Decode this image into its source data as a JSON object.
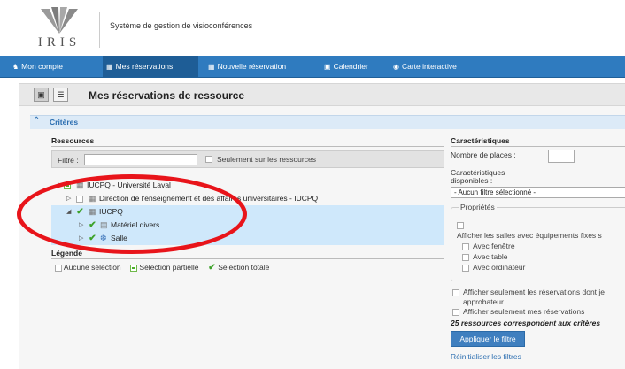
{
  "app": {
    "logo_text": "IRIS",
    "title": "Système de gestion de visioconférences"
  },
  "nav": {
    "items": [
      {
        "label": "Mon compte",
        "icon": "user-icon",
        "active": false
      },
      {
        "label": "Mes réservations",
        "icon": "list-icon",
        "active": true
      },
      {
        "label": "Nouvelle réservation",
        "icon": "list-icon",
        "active": false
      },
      {
        "label": "Calendrier",
        "icon": "calendar-icon",
        "active": false
      },
      {
        "label": "Carte interactive",
        "icon": "globe-icon",
        "active": false
      }
    ]
  },
  "page": {
    "title": "Mes réservations de ressource"
  },
  "criteria": {
    "label": "Critères"
  },
  "resources": {
    "heading": "Ressources",
    "filter_label": "Filtre :",
    "filter_value": "",
    "only_resources_label": "Seulement sur les ressources",
    "tree": [
      {
        "label": "IUCPQ - Université Laval",
        "state": "partial",
        "expanded": true,
        "icon": "building-icon",
        "highlight": false
      },
      {
        "label": "Direction de l'enseignement et des affaires universitaires - IUCPQ",
        "state": "none",
        "expanded": false,
        "icon": "building-icon",
        "highlight": false
      },
      {
        "label": "IUCPQ",
        "state": "checked",
        "expanded": true,
        "icon": "building-icon",
        "highlight": true
      },
      {
        "label": "Matériel divers",
        "state": "checked",
        "expanded": false,
        "icon": "equipment-icon",
        "highlight": true
      },
      {
        "label": "Salle",
        "state": "checked",
        "expanded": false,
        "icon": "room-icon",
        "highlight": true
      }
    ]
  },
  "legend": {
    "heading": "Légende",
    "none": "Aucune sélection",
    "partial": "Sélection partielle",
    "total": "Sélection totale"
  },
  "characteristics": {
    "heading": "Caractéristiques",
    "places_label": "Nombre de places :",
    "places_value": "",
    "available_label": "Caractéristiques disponibles :",
    "select_value": "- Aucun filtre sélectionné -",
    "properties_legend": "Propriétés",
    "show_rooms_label": "Afficher les salles avec équipements fixes s",
    "with_window": "Avec fenêtre",
    "with_table": "Avec table",
    "with_computer": "Avec ordinateur",
    "approver_label_1": "Afficher seulement les réservations dont je",
    "approver_label_2": "approbateur",
    "mine_label": "Afficher seulement mes réservations",
    "count_text": "25 ressources correspondent aux critères",
    "apply_button": "Appliquer le filtre",
    "reset_link": "Réinitialiser les filtres"
  },
  "colors": {
    "nav_bg": "#2f7bbf",
    "nav_active": "#1e5d96",
    "highlight_row": "#cfe8fb",
    "annotation": "#e8141a",
    "check_green": "#3da22a"
  }
}
